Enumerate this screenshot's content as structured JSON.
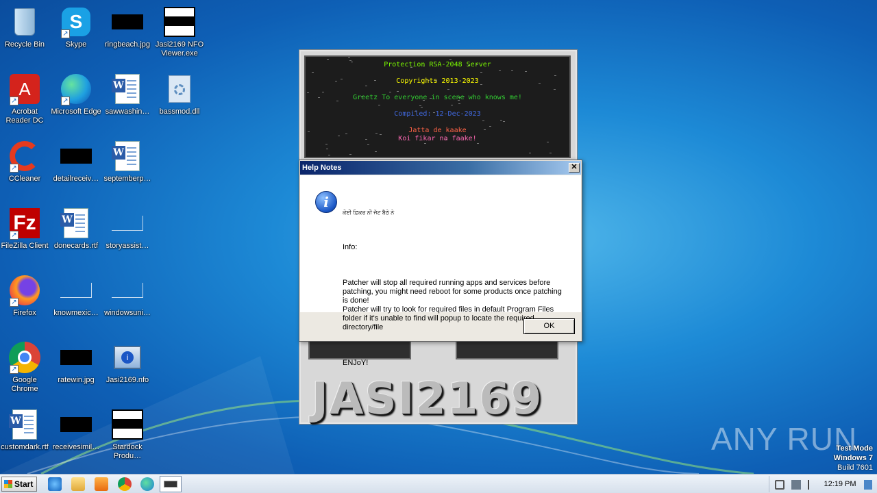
{
  "desktop": {
    "icons": [
      {
        "label": "Recycle Bin",
        "icon": "recycle-bin-icon"
      },
      {
        "label": "Skype",
        "icon": "skype-icon"
      },
      {
        "label": "ringbeach.jpg",
        "icon": "image-file-icon"
      },
      {
        "label": "Jasi2169 NFO Viewer.exe",
        "icon": "nfo-viewer-icon"
      },
      {
        "label": "Acrobat Reader DC",
        "icon": "acrobat-icon"
      },
      {
        "label": "Microsoft Edge",
        "icon": "edge-icon"
      },
      {
        "label": "sawwashin…",
        "icon": "word-doc-icon"
      },
      {
        "label": "bassmod.dll",
        "icon": "dll-icon"
      },
      {
        "label": "CCleaner",
        "icon": "ccleaner-icon"
      },
      {
        "label": "detailreceiv…",
        "icon": "image-file-icon"
      },
      {
        "label": "septemberp…",
        "icon": "word-doc-icon"
      },
      {
        "label": "FileZilla Client",
        "icon": "filezilla-icon"
      },
      {
        "label": "donecards.rtf",
        "icon": "word-doc-icon"
      },
      {
        "label": "storyassist…",
        "icon": "blank-file-icon"
      },
      {
        "label": "Firefox",
        "icon": "firefox-icon"
      },
      {
        "label": "knowmexic…",
        "icon": "blank-file-icon"
      },
      {
        "label": "windowsuni…",
        "icon": "blank-file-icon"
      },
      {
        "label": "Google Chrome",
        "icon": "chrome-icon"
      },
      {
        "label": "ratewin.jpg",
        "icon": "image-file-icon"
      },
      {
        "label": "Jasi2169.nfo",
        "icon": "nfo-file-icon"
      },
      {
        "label": "customdark.rtf",
        "icon": "word-doc-icon"
      },
      {
        "label": "receivesimil…",
        "icon": "image-file-icon"
      },
      {
        "label": "Stardock Produ…",
        "icon": "installer-icon"
      }
    ]
  },
  "patcher": {
    "lines": [
      {
        "text": "Protection RSA-2048 Server",
        "color": "#7cfc00"
      },
      {
        "text": "Copyrights 2013-2023",
        "color": "#ffff00"
      },
      {
        "text": "Greetz To everyone in scene who knows me!",
        "color": "#32cd32"
      },
      {
        "text": "Compiled: 12-Dec-2023",
        "color": "#4169e1"
      },
      {
        "text": "Jatta de kaake",
        "color": "#ff6347"
      },
      {
        "text": "Koi fikar na faake!",
        "color": "#ff69b4"
      }
    ],
    "logo_text": "JASI2169"
  },
  "dialog": {
    "title": "Help Notes",
    "close_glyph": "✕",
    "punjabi_line": "ਕੋਈ ਫ਼ਿਕਰ ਨੀ ਜੱਟ ਬੈਠੇ ਨੇ",
    "info_heading": "Info:",
    "body": "Patcher will stop all required running apps and services before patching, you might need reboot for some products once patching is done!\nPatcher will try to look for required files in default Program Files folder if it's unable to find will popup to locate the required directory/file",
    "closing": "ENJoY!",
    "ok_label": "OK"
  },
  "watermark": "ANY RUN",
  "test_mode": {
    "line1": "Test Mode",
    "line2": "Windows 7",
    "line3": "Build 7601"
  },
  "taskbar": {
    "start_label": "Start",
    "clock": "12:19 PM"
  }
}
